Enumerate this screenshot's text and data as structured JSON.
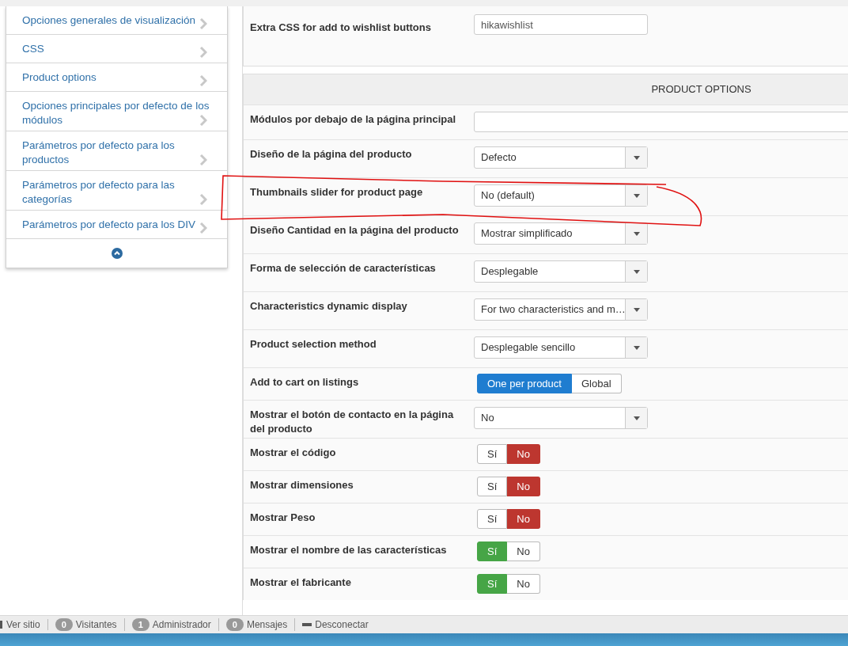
{
  "sidebar": {
    "items": [
      {
        "label": "Opciones generales de visualización"
      },
      {
        "label": "CSS"
      },
      {
        "label": "Product options"
      },
      {
        "label": "Opciones principales por defecto de los módulos"
      },
      {
        "label": "Parámetros por defecto para los productos"
      },
      {
        "label": "Parámetros por defecto para las categorías"
      },
      {
        "label": "Parámetros por defecto para los DIV"
      }
    ]
  },
  "extra_css": {
    "label": "Extra CSS for add to wishlist buttons",
    "value": "hikawishlist"
  },
  "product_options": {
    "title": "PRODUCT OPTIONS",
    "rows": [
      {
        "kind": "text",
        "label": "Módulos por debajo de la página principal",
        "value": ""
      },
      {
        "kind": "select",
        "label": "Diseño de la página del producto",
        "value": "Defecto"
      },
      {
        "kind": "select",
        "label": "Thumbnails slider for product page",
        "value": "No (default)"
      },
      {
        "kind": "select",
        "label": "Diseño Cantidad en la página del producto",
        "value": "Mostrar simplificado"
      },
      {
        "kind": "select",
        "label": "Forma de selección de características",
        "value": "Desplegable"
      },
      {
        "kind": "select",
        "label": "Characteristics dynamic display",
        "value": "For two characteristics and m…"
      },
      {
        "kind": "select",
        "label": "Product selection method",
        "value": "Desplegable sencillo"
      },
      {
        "kind": "toggle",
        "label": "Add to cart on listings",
        "options": [
          {
            "label": "One per product",
            "selected": true,
            "color": "#1f7dd0"
          },
          {
            "label": "Global",
            "selected": false
          }
        ]
      },
      {
        "kind": "select",
        "label": "Mostrar el botón de contacto en la página del producto",
        "value": "No"
      },
      {
        "kind": "toggle",
        "label": "Mostrar el código",
        "options": [
          {
            "label": "Sí",
            "selected": false
          },
          {
            "label": "No",
            "selected": true,
            "color": "#bd362f"
          }
        ]
      },
      {
        "kind": "toggle",
        "label": "Mostrar dimensiones",
        "options": [
          {
            "label": "Sí",
            "selected": false
          },
          {
            "label": "No",
            "selected": true,
            "color": "#bd362f"
          }
        ]
      },
      {
        "kind": "toggle",
        "label": "Mostrar Peso",
        "options": [
          {
            "label": "Sí",
            "selected": false
          },
          {
            "label": "No",
            "selected": true,
            "color": "#bd362f"
          }
        ]
      },
      {
        "kind": "toggle",
        "label": "Mostrar el nombre de las características",
        "options": [
          {
            "label": "Sí",
            "selected": true,
            "color": "#46a546"
          },
          {
            "label": "No",
            "selected": false
          }
        ]
      },
      {
        "kind": "toggle",
        "label": "Mostrar el fabricante",
        "options": [
          {
            "label": "Sí",
            "selected": true,
            "color": "#46a546"
          },
          {
            "label": "No",
            "selected": false
          }
        ]
      }
    ]
  },
  "status_bar": {
    "items": [
      {
        "kind": "link",
        "label": "Ver sitio"
      },
      {
        "kind": "counter",
        "count": "0",
        "label": "Visitantes"
      },
      {
        "kind": "counter",
        "count": "1",
        "label": "Administrador"
      },
      {
        "kind": "counter",
        "count": "0",
        "label": "Mensajes"
      },
      {
        "kind": "logout",
        "label": "Desconectar"
      }
    ]
  }
}
